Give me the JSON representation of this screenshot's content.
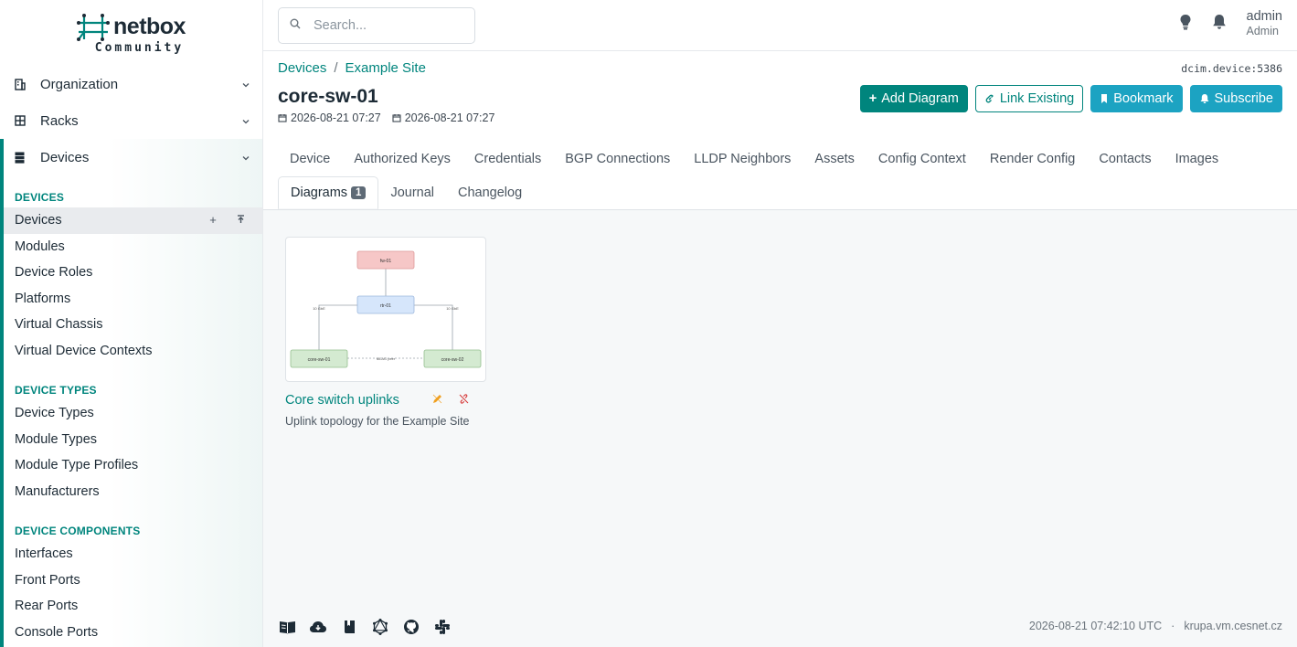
{
  "brand": {
    "name": "netbox",
    "edition": "Community"
  },
  "sidebar": {
    "groups": [
      {
        "label": "Organization",
        "icon": "building-icon"
      },
      {
        "label": "Racks",
        "icon": "rack-icon"
      },
      {
        "label": "Devices",
        "icon": "server-icon"
      }
    ],
    "sections": [
      {
        "title": "DEVICES",
        "items": [
          "Devices",
          "Modules",
          "Device Roles",
          "Platforms",
          "Virtual Chassis",
          "Virtual Device Contexts"
        ]
      },
      {
        "title": "DEVICE TYPES",
        "items": [
          "Device Types",
          "Module Types",
          "Module Type Profiles",
          "Manufacturers"
        ]
      },
      {
        "title": "DEVICE COMPONENTS",
        "items": [
          "Interfaces",
          "Front Ports",
          "Rear Ports",
          "Console Ports"
        ]
      }
    ]
  },
  "search": {
    "placeholder": "Search..."
  },
  "user": {
    "name": "admin",
    "role": "Admin"
  },
  "breadcrumb": [
    "Devices",
    "Example Site"
  ],
  "object_id": "dcim.device:5386",
  "page": {
    "title": "core-sw-01",
    "created": "2026-08-21 07:27",
    "updated": "2026-08-21 07:27"
  },
  "buttons": {
    "add": "Add Diagram",
    "link": "Link Existing",
    "bookmark": "Bookmark",
    "subscribe": "Subscribe"
  },
  "tabs_row1": [
    "Device",
    "Authorized Keys",
    "Credentials",
    "BGP Connections",
    "LLDP Neighbors",
    "Assets",
    "Config Context",
    "Render Config",
    "Contacts",
    "Images"
  ],
  "tabs_row2": {
    "active": "Diagrams",
    "active_count": "1",
    "others": [
      "Journal",
      "Changelog"
    ]
  },
  "diagram_card": {
    "title": "Core switch uplinks",
    "description": "Uplink topology for the Example Site",
    "thumbnail": {
      "nodes": [
        "fw-01",
        "rtr-01",
        "core-sw-01",
        "core-sw-02"
      ],
      "links": [
        "10 GbE",
        "10 GbE",
        "MLAG peer"
      ]
    }
  },
  "footer": {
    "icons": [
      "docs-icon",
      "api-icon",
      "book-icon",
      "graphql-icon",
      "github-icon",
      "slack-icon"
    ],
    "timestamp": "2026-08-21 07:42:10 UTC",
    "separator": "·",
    "host": "krupa.vm.cesnet.cz"
  },
  "colors": {
    "accent": "#00857d",
    "cyan": "#1ca3c2"
  }
}
